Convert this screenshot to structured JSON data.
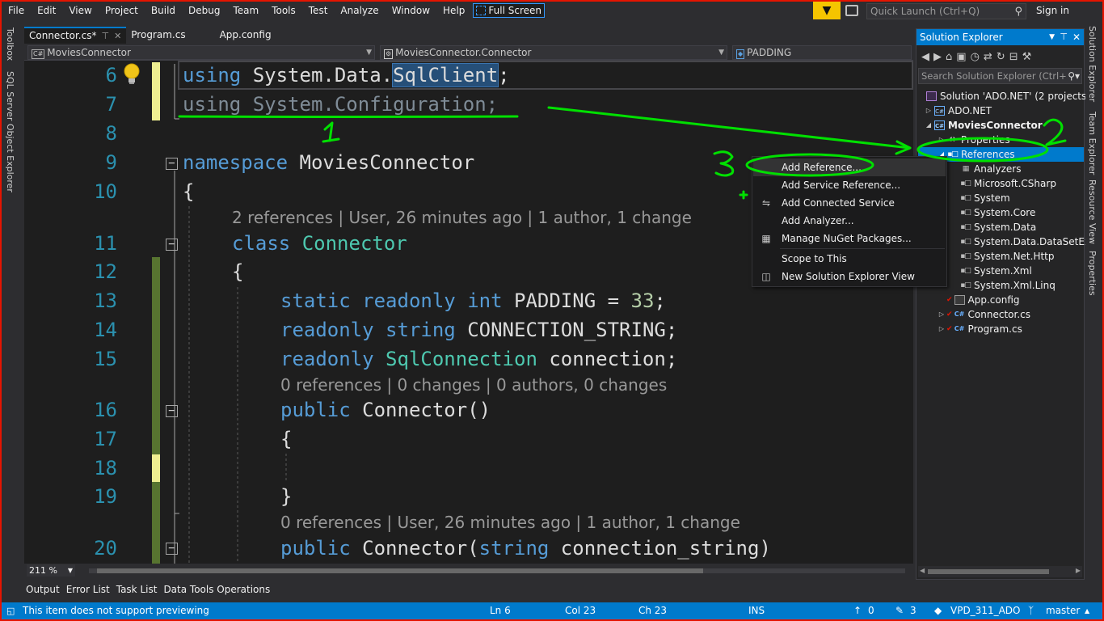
{
  "menubar": {
    "items": [
      "File",
      "Edit",
      "View",
      "Project",
      "Build",
      "Debug",
      "Team",
      "Tools",
      "Test",
      "Analyze",
      "Window",
      "Help"
    ],
    "fullscreen_label": "Full Screen",
    "quick_launch_placeholder": "Quick Launch (Ctrl+Q)",
    "sign_in": "Sign in"
  },
  "left_tabs": [
    "Toolbox",
    "SQL Server Object Explorer"
  ],
  "right_tabs": [
    "Solution Explorer",
    "Team Explorer",
    "Resource View",
    "Properties"
  ],
  "doc_tabs": [
    {
      "label": "Connector.cs*",
      "active": true
    },
    {
      "label": "Program.cs",
      "active": false
    },
    {
      "label": "App.config",
      "active": false
    }
  ],
  "navbar": {
    "project": "MoviesConnector",
    "type": "MoviesConnector.Connector",
    "member": "PADDING"
  },
  "editor": {
    "lines": [
      {
        "num": "6",
        "text": "using System.Data.SqlClient;"
      },
      {
        "num": "7",
        "text": "using System.Configuration;"
      },
      {
        "num": "8",
        "text": ""
      },
      {
        "num": "9",
        "text": "namespace MoviesConnector"
      },
      {
        "num": "10",
        "text": "{"
      },
      {
        "num": "11",
        "text": "class Connector"
      },
      {
        "num": "12",
        "text": "{"
      },
      {
        "num": "13",
        "text": "static readonly int PADDING = 33;"
      },
      {
        "num": "14",
        "text": "readonly string CONNECTION_STRING;"
      },
      {
        "num": "15",
        "text": "readonly SqlConnection connection;"
      },
      {
        "num": "16",
        "text": "public Connector()"
      },
      {
        "num": "17",
        "text": "{"
      },
      {
        "num": "18",
        "text": ""
      },
      {
        "num": "19",
        "text": "}"
      },
      {
        "num": "20",
        "text": "public Connector(string connection_string)"
      }
    ],
    "code_lens": [
      "2 references | User, 26 minutes ago | 1 author, 1 change",
      "0 references | 0 changes | 0 authors, 0 changes",
      "0 references | User, 26 minutes ago | 1 author, 1 change"
    ],
    "zoom": "211 %"
  },
  "bottom_tabs": [
    "Output",
    "Error List",
    "Task List",
    "Data Tools Operations"
  ],
  "status": {
    "message": "This item does not support previewing",
    "ln": "Ln 6",
    "col": "Col 23",
    "ch": "Ch 23",
    "mode": "INS",
    "up_count": "0",
    "pencil_count": "3",
    "repo": "VPD_311_ADO",
    "branch": "master"
  },
  "solution_explorer": {
    "title": "Solution Explorer",
    "search_placeholder": "Search Solution Explorer (Ctrl+;)",
    "tree": [
      {
        "label": "Solution 'ADO.NET' (2 projects)",
        "kind": "solution"
      },
      {
        "label": "ADO.NET",
        "kind": "project"
      },
      {
        "label": "MoviesConnector",
        "kind": "project"
      },
      {
        "label": "Properties",
        "kind": "folder"
      },
      {
        "label": "References",
        "kind": "references"
      },
      {
        "label": "Analyzers",
        "kind": "analyzer"
      },
      {
        "label": "Microsoft.CSharp",
        "kind": "ref"
      },
      {
        "label": "System",
        "kind": "ref"
      },
      {
        "label": "System.Core",
        "kind": "ref"
      },
      {
        "label": "System.Data",
        "kind": "ref"
      },
      {
        "label": "System.Data.DataSetExtensions",
        "kind": "ref"
      },
      {
        "label": "System.Net.Http",
        "kind": "ref"
      },
      {
        "label": "System.Xml",
        "kind": "ref"
      },
      {
        "label": "System.Xml.Linq",
        "kind": "ref"
      },
      {
        "label": "App.config",
        "kind": "config"
      },
      {
        "label": "Connector.cs",
        "kind": "cs"
      },
      {
        "label": "Program.cs",
        "kind": "cs"
      }
    ]
  },
  "context_menu": {
    "items": [
      {
        "label": "Add Reference...",
        "icon": "none"
      },
      {
        "label": "Add Service Reference...",
        "icon": "none"
      },
      {
        "label": "Add Connected Service",
        "icon": "connected-service-icon"
      },
      {
        "label": "Add Analyzer...",
        "icon": "none"
      },
      {
        "label": "Manage NuGet Packages...",
        "icon": "nuget-icon"
      },
      {
        "label": "Scope to This",
        "icon": "none"
      },
      {
        "label": "New Solution Explorer View",
        "icon": "new-view-icon"
      }
    ]
  },
  "annotations": {
    "marks": [
      "1",
      "2",
      "3"
    ],
    "color": "#00e000"
  },
  "colors": {
    "accent": "#007acc",
    "frame_border": "#e51400",
    "filter_button": "#f5c400"
  }
}
